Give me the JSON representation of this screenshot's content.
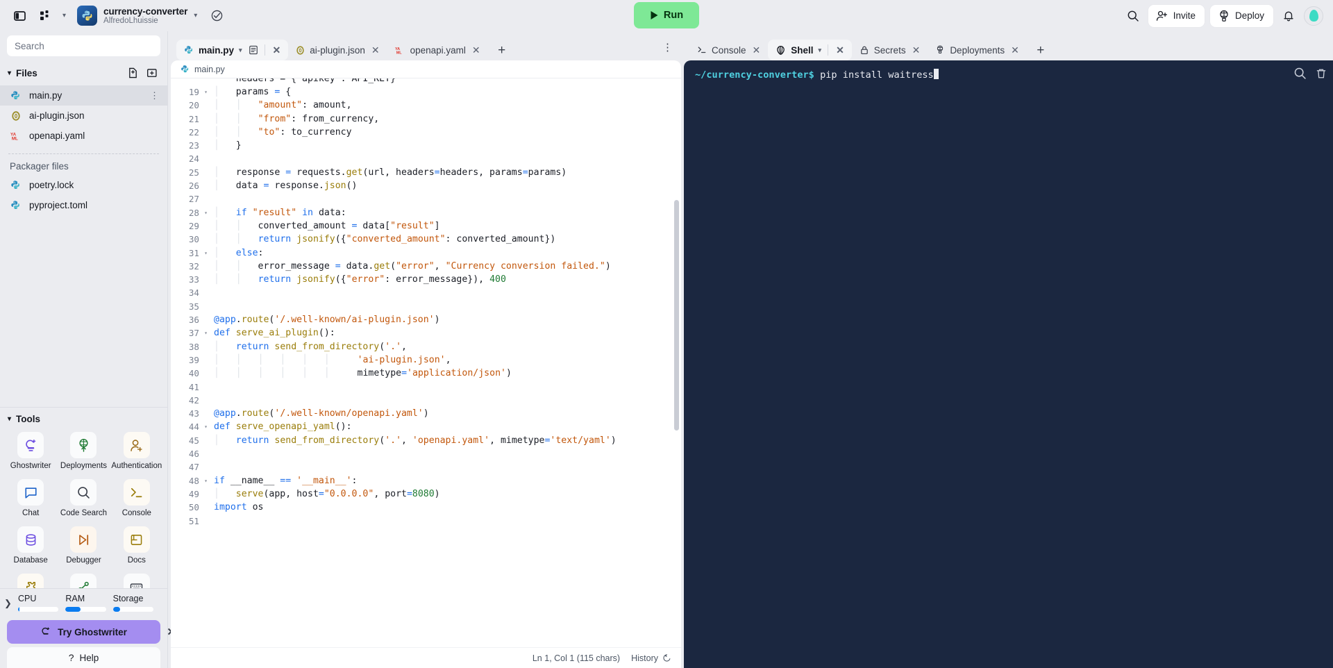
{
  "header": {
    "project_name": "currency-converter",
    "project_owner": "AlfredoLhuissie",
    "run_label": "Run",
    "invite_label": "Invite",
    "deploy_label": "Deploy",
    "icons": {
      "sidebar_toggle": "panel-toggle-icon",
      "apps": "apps-grid-icon",
      "project_chevron": "chevron-down-icon",
      "status": "check-cloud-icon",
      "search": "search-icon",
      "invite": "user-plus-icon",
      "deploy": "deploy-balloon-icon",
      "notifications": "bell-icon",
      "avatar": "avatar-icon"
    },
    "accent_run": "#7ee896",
    "accent_ghostwriter": "#a48df0"
  },
  "sidebar": {
    "search": {
      "placeholder": "Search",
      "value": ""
    },
    "files_section": {
      "label": "Files",
      "new_file_icon": "new-file-icon",
      "new_folder_icon": "new-folder-icon"
    },
    "files": [
      {
        "name": "main.py",
        "icon": "python-file-icon",
        "active": true
      },
      {
        "name": "ai-plugin.json",
        "icon": "json-file-icon",
        "active": false
      },
      {
        "name": "openapi.yaml",
        "icon": "yaml-file-icon",
        "active": false
      }
    ],
    "packager_label": "Packager files",
    "packager_files": [
      {
        "name": "poetry.lock",
        "icon": "python-file-icon"
      },
      {
        "name": "pyproject.toml",
        "icon": "python-file-icon"
      }
    ],
    "tools_section": {
      "label": "Tools"
    },
    "tools": [
      {
        "label": "Ghostwriter",
        "icon": "ghostwriter-icon"
      },
      {
        "label": "Deployments",
        "icon": "deployments-icon"
      },
      {
        "label": "Authentication",
        "icon": "authentication-icon"
      },
      {
        "label": "Chat",
        "icon": "chat-icon"
      },
      {
        "label": "Code Search",
        "icon": "code-search-icon"
      },
      {
        "label": "Console",
        "icon": "console-icon"
      },
      {
        "label": "Database",
        "icon": "database-icon"
      },
      {
        "label": "Debugger",
        "icon": "debugger-icon"
      },
      {
        "label": "Docs",
        "icon": "docs-icon"
      },
      {
        "label": "",
        "icon": "extension-icon"
      },
      {
        "label": "",
        "icon": "git-icon"
      },
      {
        "label": "",
        "icon": "keyboard-icon"
      }
    ],
    "metrics": [
      {
        "label": "CPU",
        "percent": 4
      },
      {
        "label": "RAM",
        "percent": 38
      },
      {
        "label": "Storage",
        "percent": 17
      }
    ],
    "ghostwriter_button": "Try Ghostwriter",
    "help_button": "Help"
  },
  "editor": {
    "tabs": [
      {
        "label": "main.py",
        "icon": "python-file-icon",
        "active": true,
        "has_chevron": true,
        "has_preview_icon": true
      },
      {
        "label": "ai-plugin.json",
        "icon": "json-file-icon",
        "active": false
      },
      {
        "label": "openapi.yaml",
        "icon": "yaml-file-icon",
        "active": false
      }
    ],
    "add_tab_label": "+",
    "kebab_label": "⋮",
    "breadcrumb": "main.py",
    "status": {
      "cursor": "Ln 1, Col 1 (115 chars)",
      "history": "History"
    },
    "first_partial_line": "    headers = {'apikey': API_KEY}",
    "code": [
      {
        "n": 19,
        "fold": true,
        "html": "    params = {"
      },
      {
        "n": 20,
        "fold": false,
        "html": "        \"amount\": amount,"
      },
      {
        "n": 21,
        "fold": false,
        "html": "        \"from\": from_currency,"
      },
      {
        "n": 22,
        "fold": false,
        "html": "        \"to\": to_currency"
      },
      {
        "n": 23,
        "fold": false,
        "html": "    }"
      },
      {
        "n": 24,
        "fold": false,
        "html": ""
      },
      {
        "n": 25,
        "fold": false,
        "html": "    response = requests.get(url, headers=headers, params=params)"
      },
      {
        "n": 26,
        "fold": false,
        "html": "    data = response.json()"
      },
      {
        "n": 27,
        "fold": false,
        "html": ""
      },
      {
        "n": 28,
        "fold": true,
        "html": "    if \"result\" in data:"
      },
      {
        "n": 29,
        "fold": false,
        "html": "        converted_amount = data[\"result\"]"
      },
      {
        "n": 30,
        "fold": false,
        "html": "        return jsonify({\"converted_amount\": converted_amount})"
      },
      {
        "n": 31,
        "fold": true,
        "html": "    else:"
      },
      {
        "n": 32,
        "fold": false,
        "html": "        error_message = data.get(\"error\", \"Currency conversion failed.\")"
      },
      {
        "n": 33,
        "fold": false,
        "html": "        return jsonify({\"error\": error_message}), 400"
      },
      {
        "n": 34,
        "fold": false,
        "html": ""
      },
      {
        "n": 35,
        "fold": false,
        "html": ""
      },
      {
        "n": 36,
        "fold": false,
        "html": "@app.route('/.well-known/ai-plugin.json')"
      },
      {
        "n": 37,
        "fold": true,
        "html": "def serve_ai_plugin():"
      },
      {
        "n": 38,
        "fold": false,
        "html": "    return send_from_directory('.',"
      },
      {
        "n": 39,
        "fold": false,
        "html": "                          'ai-plugin.json',"
      },
      {
        "n": 40,
        "fold": false,
        "html": "                          mimetype='application/json')"
      },
      {
        "n": 41,
        "fold": false,
        "html": ""
      },
      {
        "n": 42,
        "fold": false,
        "html": ""
      },
      {
        "n": 43,
        "fold": false,
        "html": "@app.route('/.well-known/openapi.yaml')"
      },
      {
        "n": 44,
        "fold": true,
        "html": "def serve_openapi_yaml():"
      },
      {
        "n": 45,
        "fold": false,
        "html": "    return send_from_directory('.', 'openapi.yaml', mimetype='text/yaml')"
      },
      {
        "n": 46,
        "fold": false,
        "html": ""
      },
      {
        "n": 47,
        "fold": false,
        "html": ""
      },
      {
        "n": 48,
        "fold": true,
        "html": "if __name__ == '__main__':"
      },
      {
        "n": 49,
        "fold": false,
        "html": "    serve(app, host=\"0.0.0.0\", port=8080)"
      },
      {
        "n": 50,
        "fold": false,
        "html": "import os"
      },
      {
        "n": 51,
        "fold": false,
        "html": ""
      }
    ]
  },
  "right_panel": {
    "tabs": [
      {
        "label": "Console",
        "icon": "console-icon",
        "active": false,
        "closable": true
      },
      {
        "label": "Shell",
        "icon": "shell-icon",
        "active": true,
        "closable": true,
        "has_chevron": true
      },
      {
        "label": "Secrets",
        "icon": "lock-icon",
        "active": false,
        "closable": true
      },
      {
        "label": "Deployments",
        "icon": "deployments-icon",
        "active": false,
        "closable": true
      }
    ],
    "add_tab_label": "+",
    "shell": {
      "prompt": "~/currency-converter$ ",
      "command": "pip install waitress",
      "background": "#1b2740",
      "search_icon": "search-icon",
      "trash_icon": "trash-icon"
    }
  }
}
